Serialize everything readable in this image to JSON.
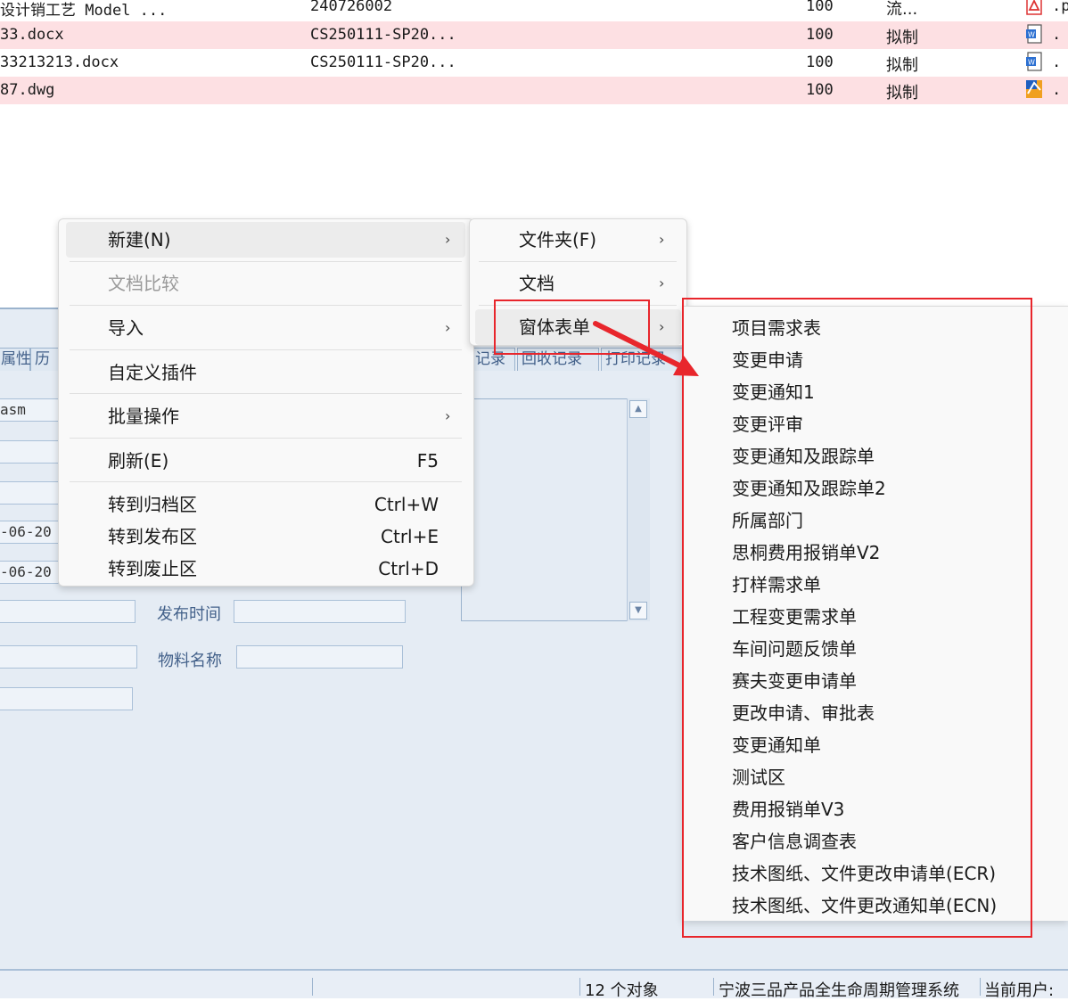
{
  "file_rows": [
    {
      "name": "设计销工艺 Model ...",
      "code": "240726002",
      "version": "100",
      "state": "流...",
      "icon": "pdf-icon",
      "ext": ".p",
      "highlight": false
    },
    {
      "name": "33.docx",
      "code": "CS250111-SP20...",
      "version": "100",
      "state": "拟制",
      "icon": "word-icon",
      "ext": ".",
      "highlight": true
    },
    {
      "name": "33213213.docx",
      "code": "CS250111-SP20...",
      "version": "100",
      "state": "拟制",
      "icon": "word-icon",
      "ext": ".",
      "highlight": false
    },
    {
      "name": "87.dwg",
      "code": "",
      "version": "100",
      "state": "拟制",
      "icon": "dwg-icon",
      "ext": ".",
      "highlight": true
    }
  ],
  "panel": {
    "tabs": [
      "属性",
      "历",
      "记录",
      "回收记录",
      "打印记录"
    ],
    "field_values": [
      "asm",
      "-06-20",
      "-06-20"
    ],
    "labels": {
      "publish_time": "发布时间",
      "material_name": "物料名称"
    }
  },
  "context_menu": {
    "items": [
      {
        "label": "新建(N)",
        "shortcut": "",
        "submenu": true,
        "disabled": false
      },
      {
        "label": "文档比较",
        "shortcut": "",
        "submenu": false,
        "disabled": true
      },
      {
        "label": "导入",
        "shortcut": "",
        "submenu": true,
        "disabled": false
      },
      {
        "label": "自定义插件",
        "shortcut": "",
        "submenu": false,
        "disabled": false
      },
      {
        "label": "批量操作",
        "shortcut": "",
        "submenu": true,
        "disabled": false
      },
      {
        "label": "刷新(E)",
        "shortcut": "F5",
        "submenu": false,
        "disabled": false
      },
      {
        "label": "转到归档区",
        "shortcut": "Ctrl+W",
        "submenu": false,
        "disabled": false
      },
      {
        "label": "转到发布区",
        "shortcut": "Ctrl+E",
        "submenu": false,
        "disabled": false
      },
      {
        "label": "转到废止区",
        "shortcut": "Ctrl+D",
        "submenu": false,
        "disabled": false
      }
    ]
  },
  "new_submenu": {
    "items": [
      {
        "label": "文件夹(F)",
        "submenu": true
      },
      {
        "label": "文档",
        "submenu": true
      },
      {
        "label": "窗体表单",
        "submenu": true
      }
    ]
  },
  "form_submenu": {
    "items": [
      "项目需求表",
      "变更申请",
      "变更通知1",
      "变更评审",
      "变更通知及跟踪单",
      "变更通知及跟踪单2",
      "所属部门",
      "思桐费用报销单V2",
      "打样需求单",
      "工程变更需求单",
      "车间问题反馈单",
      "赛夫变更申请单",
      "更改申请、审批表",
      "变更通知单",
      "测试区",
      "费用报销单V3",
      "客户信息调查表",
      "技术图纸、文件更改申请单(ECR)",
      "技术图纸、文件更改通知单(ECN)"
    ]
  },
  "statusbar": {
    "object_count": "12 个对象",
    "system_name": "宁波三品产品全生命周期管理系统",
    "current_user": "当前用户:"
  },
  "arrow_glyph": "›",
  "colors": {
    "annotation_red": "#e8262c",
    "row_highlight": "#fde0e3",
    "panel_bg": "#e5ecf4",
    "menu_bg": "#f9f9f9"
  }
}
